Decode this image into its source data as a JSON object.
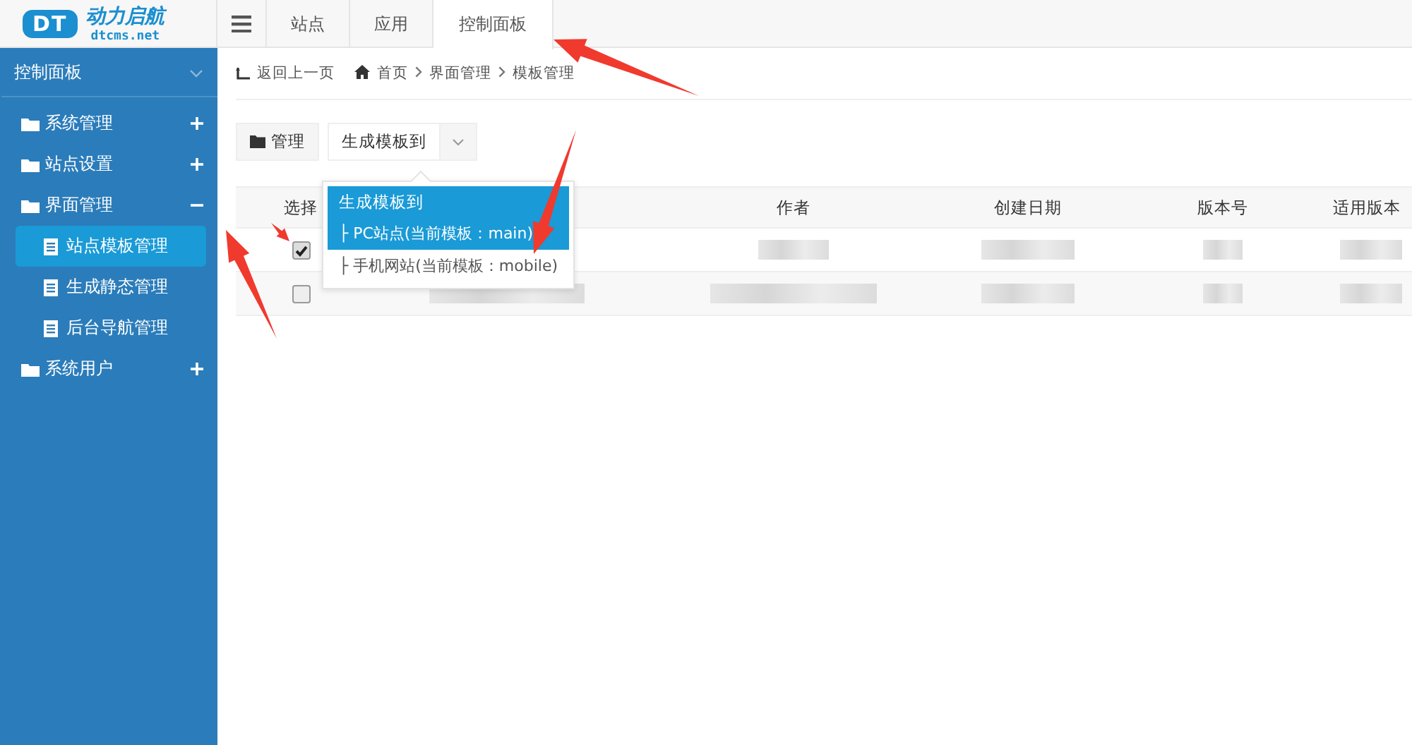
{
  "logo": {
    "mark": "DT",
    "name": "动力启航",
    "url": "dtcms.net"
  },
  "top_tabs": [
    {
      "label": "站点",
      "selected": false
    },
    {
      "label": "应用",
      "selected": false
    },
    {
      "label": "控制面板",
      "selected": true
    }
  ],
  "sidebar": {
    "title": "控制面板",
    "items": [
      {
        "label": "系统管理",
        "expanded": false
      },
      {
        "label": "站点设置",
        "expanded": false
      },
      {
        "label": "界面管理",
        "expanded": true,
        "children": [
          {
            "label": "站点模板管理",
            "selected": true
          },
          {
            "label": "生成静态管理",
            "selected": false
          },
          {
            "label": "后台导航管理",
            "selected": false
          }
        ]
      },
      {
        "label": "系统用户",
        "expanded": false
      }
    ]
  },
  "breadcrumb": {
    "back": "返回上一页",
    "path": [
      "首页",
      "界面管理",
      "模板管理"
    ]
  },
  "toolbar": {
    "manage_button": "管理",
    "generate_button": "生成模板到"
  },
  "dropdown": {
    "header": "生成模板到",
    "items": [
      {
        "label": "├ PC站点(当前模板：main)",
        "selected": true
      },
      {
        "label": "├ 手机网站(当前模板：mobile)",
        "selected": false
      }
    ]
  },
  "table": {
    "columns": [
      "选择",
      "",
      "作者",
      "创建日期",
      "版本号",
      "适用版本"
    ],
    "rows": [
      {
        "checked": true
      },
      {
        "checked": false
      }
    ]
  }
}
